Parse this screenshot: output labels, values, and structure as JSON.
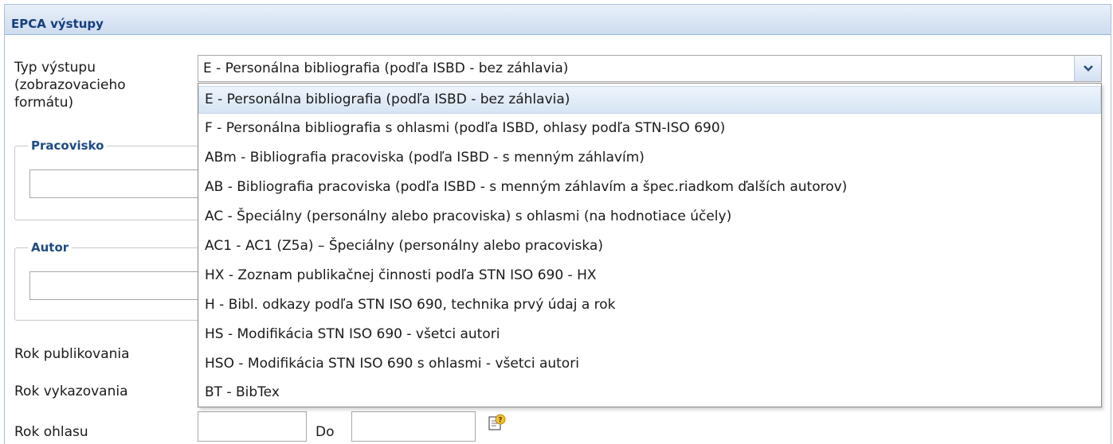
{
  "panel": {
    "title": "EPCA výstupy"
  },
  "form": {
    "type_label_line1": "Typ výstupu",
    "type_label_line2": "(zobrazovacieho",
    "type_label_line3": "formátu)",
    "type_selected": "E - Personálna bibliografia (podľa ISBD - bez záhlavia)",
    "workplace_legend": "Pracovisko",
    "author_legend": "Autor",
    "year_published_label": "Rok publikovania",
    "year_reported_label": "Rok vykazovania",
    "year_citation_label": "Rok ohlasu",
    "to_label": "Do"
  },
  "dropdown": {
    "options": [
      "E - Personálna bibliografia (podľa ISBD - bez záhlavia)",
      "F - Personálna bibliografia s ohlasmi (podľa ISBD, ohlasy podľa STN-ISO 690)",
      "ABm - Bibliografia pracoviska (podľa ISBD - s menným záhlavím)",
      "AB - Bibliografia pracoviska (podľa ISBD - s menným záhlavím a špec.riadkom ďalších autorov)",
      "AC - Špeciálny (personálny alebo pracoviska) s ohlasmi (na hodnotiace účely)",
      "AC1 - AC1 (Z5a) – Špeciálny (personálny alebo pracoviska)",
      "HX - Zoznam publikačnej činnosti podľa STN ISO 690 - HX",
      "H - Bibl. odkazy podľa STN ISO 690, technika prvý údaj a rok",
      "HS - Modifikácia STN ISO 690 - všetci autori",
      "HSO - Modifikácia STN ISO 690 s ohlasmi - všetci autori",
      "BT - BibTex"
    ],
    "selected_index": 0
  },
  "colors": {
    "accent": "#153e7e",
    "header_bg": "#cddcef",
    "selected_bg": "#d6e4f4"
  },
  "icons": {
    "dropdown_arrow": "chevron-down-icon",
    "help": "help-note-icon"
  }
}
